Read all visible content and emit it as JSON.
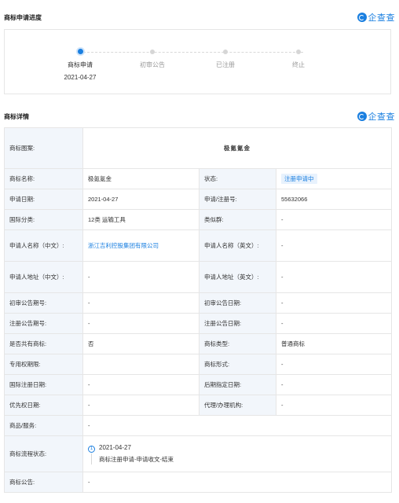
{
  "progress_section": {
    "title": "商标申请进度",
    "brand": "企查查",
    "steps": [
      {
        "label": "商标申请",
        "date": "2021-04-27",
        "active": true
      },
      {
        "label": "初审公告",
        "date": "",
        "active": false
      },
      {
        "label": "已注册",
        "date": "",
        "active": false
      },
      {
        "label": "终止",
        "date": "",
        "active": false
      }
    ]
  },
  "detail_section": {
    "title": "商标详情",
    "brand": "企查查",
    "mark_image_label": "商标图案:",
    "mark_image_text": "极氪氪金",
    "rows": {
      "name_k": "商标名称:",
      "name_v": "极氪氪金",
      "status_k": "状态:",
      "status_v": "注册申请中",
      "apply_date_k": "申请日期:",
      "apply_date_v": "2021-04-27",
      "reg_no_k": "申请/注册号:",
      "reg_no_v": "55632066",
      "intl_class_k": "国际分类:",
      "intl_class_v": "12类 运输工具",
      "similar_group_k": "类似群:",
      "similar_group_v": "-",
      "applicant_cn_k": "申请人名称（中文）:",
      "applicant_cn_v": "浙江吉利控股集团有限公司",
      "applicant_en_k": "申请人名称（英文）:",
      "applicant_en_v": "-",
      "addr_cn_k": "申请人地址（中文）:",
      "addr_cn_v": "-",
      "addr_en_k": "申请人地址（英文）:",
      "addr_en_v": "-",
      "prelim_no_k": "初审公告期号:",
      "prelim_no_v": "-",
      "prelim_date_k": "初审公告日期:",
      "prelim_date_v": "-",
      "reg_ann_no_k": "注册公告期号:",
      "reg_ann_no_v": "-",
      "reg_ann_date_k": "注册公告日期:",
      "reg_ann_date_v": "-",
      "shared_k": "是否共有商标:",
      "shared_v": "否",
      "mark_type_k": "商标类型:",
      "mark_type_v": "普通商标",
      "exclusive_k": "专用权期限:",
      "exclusive_v": "",
      "mark_form_k": "商标形式:",
      "mark_form_v": "-",
      "intl_reg_date_k": "国际注册日期:",
      "intl_reg_date_v": "-",
      "later_date_k": "后期指定日期:",
      "later_date_v": "-",
      "priority_k": "优先权日期:",
      "priority_v": "-",
      "agent_k": "代理/办理机构:",
      "agent_v": "-",
      "goods_k": "商品/服务:",
      "goods_v": "-",
      "flow_k": "商标流程状态:",
      "flow_num": "1",
      "flow_date": "2021-04-27",
      "flow_desc": "商标注册申请-申请收文-结束",
      "announce_k": "商标公告:",
      "announce_v": "-"
    }
  }
}
